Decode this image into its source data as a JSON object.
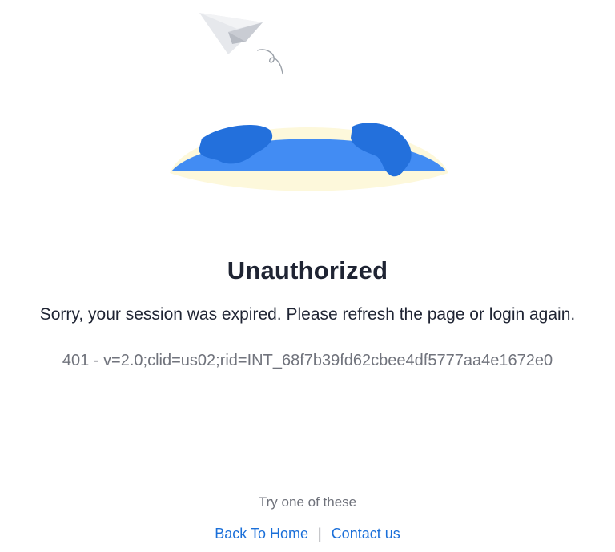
{
  "illustration": {
    "icons": [
      "paper-plane-icon",
      "globe-icon"
    ],
    "colors": {
      "globe": "#418bf2",
      "continents": "#1f6fdc",
      "glow": "#fdf7d6",
      "plane": "#dfe1e6"
    }
  },
  "error": {
    "title": "Unauthorized",
    "message": "Sorry, your session was expired. Please refresh the page or login again.",
    "code": "401 - v=2.0;clid=us02;rid=INT_68f7b39fd62cbee4df5777aa4e1672e0"
  },
  "suggestions": {
    "label": "Try one of these",
    "separator": "|",
    "links": {
      "home": "Back To Home",
      "contact": "Contact us"
    },
    "link_color": "#1a6fd9"
  }
}
